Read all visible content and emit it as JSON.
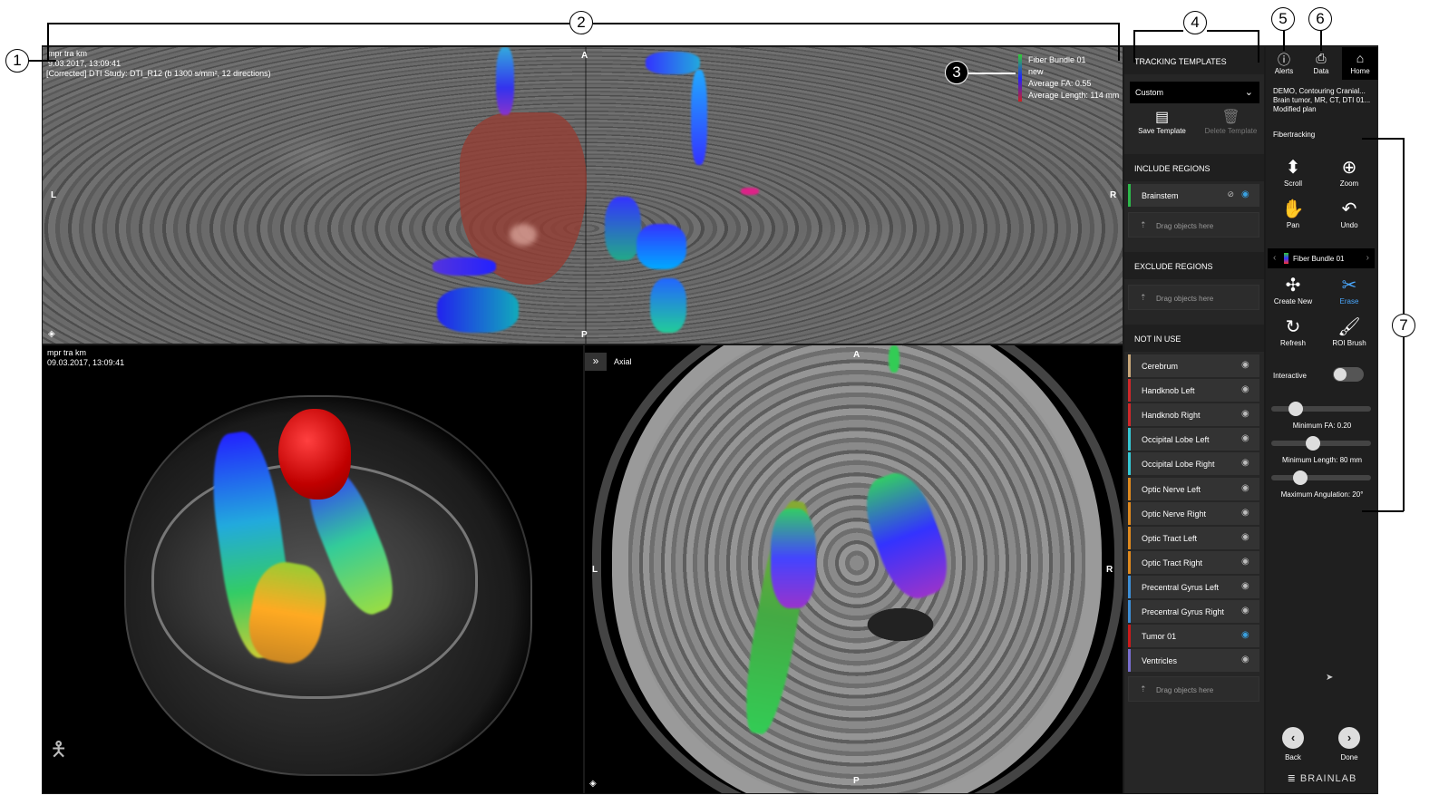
{
  "callouts": [
    "1",
    "2",
    "3",
    "4",
    "5",
    "6",
    "7"
  ],
  "viewer_top": {
    "series": "mpr tra km",
    "datetime": "9.03.2017, 13:09:41",
    "study": "[Corrected]  DTI Study: DTI_R12 (b 1300 s/mm², 12 directions)",
    "orient": {
      "top": "A",
      "bottom": "P",
      "left": "L",
      "right": "R"
    },
    "bundle_info": {
      "name": "Fiber Bundle 01",
      "state": "new",
      "fa": "Average FA: 0.55",
      "length": "Average Length: 114 mm"
    }
  },
  "viewer_3d": {
    "series": "mpr tra km",
    "datetime": "09.03.2017, 13:09:41"
  },
  "viewer_axial": {
    "label": "Axial",
    "expand_icon": "double-chevron-right-icon",
    "orient": {
      "top": "A",
      "bottom": "P",
      "left": "L",
      "right": "R"
    }
  },
  "middle": {
    "tracking_templates": "TRACKING TEMPLATES",
    "template_selected": "Custom",
    "save_template": "Save Template",
    "delete_template": "Delete Template",
    "include_regions": "INCLUDE REGIONS",
    "include_items": [
      {
        "label": "Brainstem",
        "color": "#2db84a",
        "visible": true
      }
    ],
    "exclude_regions": "EXCLUDE REGIONS",
    "not_in_use": "NOT IN USE",
    "drag_here": "Drag objects here",
    "not_in_use_items": [
      {
        "label": "Cerebrum",
        "color": "#c9a87a"
      },
      {
        "label": "Handknob Left",
        "color": "#d0282a"
      },
      {
        "label": "Handknob Right",
        "color": "#d0282a"
      },
      {
        "label": "Occipital Lobe Left",
        "color": "#35c9d6"
      },
      {
        "label": "Occipital Lobe Right",
        "color": "#35c9d6"
      },
      {
        "label": "Optic Nerve Left",
        "color": "#e08a1e"
      },
      {
        "label": "Optic Nerve Right",
        "color": "#e08a1e"
      },
      {
        "label": "Optic Tract Left",
        "color": "#e08a1e"
      },
      {
        "label": "Optic Tract Right",
        "color": "#e08a1e"
      },
      {
        "label": "Precentral Gyrus Left",
        "color": "#3d8fd6"
      },
      {
        "label": "Precentral Gyrus Right",
        "color": "#3d8fd6"
      },
      {
        "label": "Tumor 01",
        "color": "#cc1a1a",
        "visible": true
      },
      {
        "label": "Ventricles",
        "color": "#7a6fd0"
      }
    ]
  },
  "right": {
    "alerts": "Alerts",
    "data": "Data",
    "home": "Home",
    "plan_lines": [
      "DEMO, Contouring Cranial...",
      "Brain tumor, MR, CT, DTI 01...",
      "Modified plan"
    ],
    "section": "Fibertracking",
    "tools": {
      "scroll": "Scroll",
      "zoom": "Zoom",
      "pan": "Pan",
      "undo": "Undo",
      "create_new": "Create New",
      "erase": "Erase",
      "refresh": "Refresh",
      "roi_brush": "ROI Brush"
    },
    "bundle": "Fiber Bundle 01",
    "interactive": "Interactive",
    "min_fa": "Minimum FA: 0.20",
    "min_length": "Minimum Length: 80 mm",
    "max_angulation": "Maximum Angulation: 20°",
    "slider_levels": {
      "min_fa": 0.2,
      "min_length": 0.4,
      "max_angulation": 0.25
    },
    "back": "Back",
    "done": "Done",
    "brand": "BRAINLAB"
  }
}
